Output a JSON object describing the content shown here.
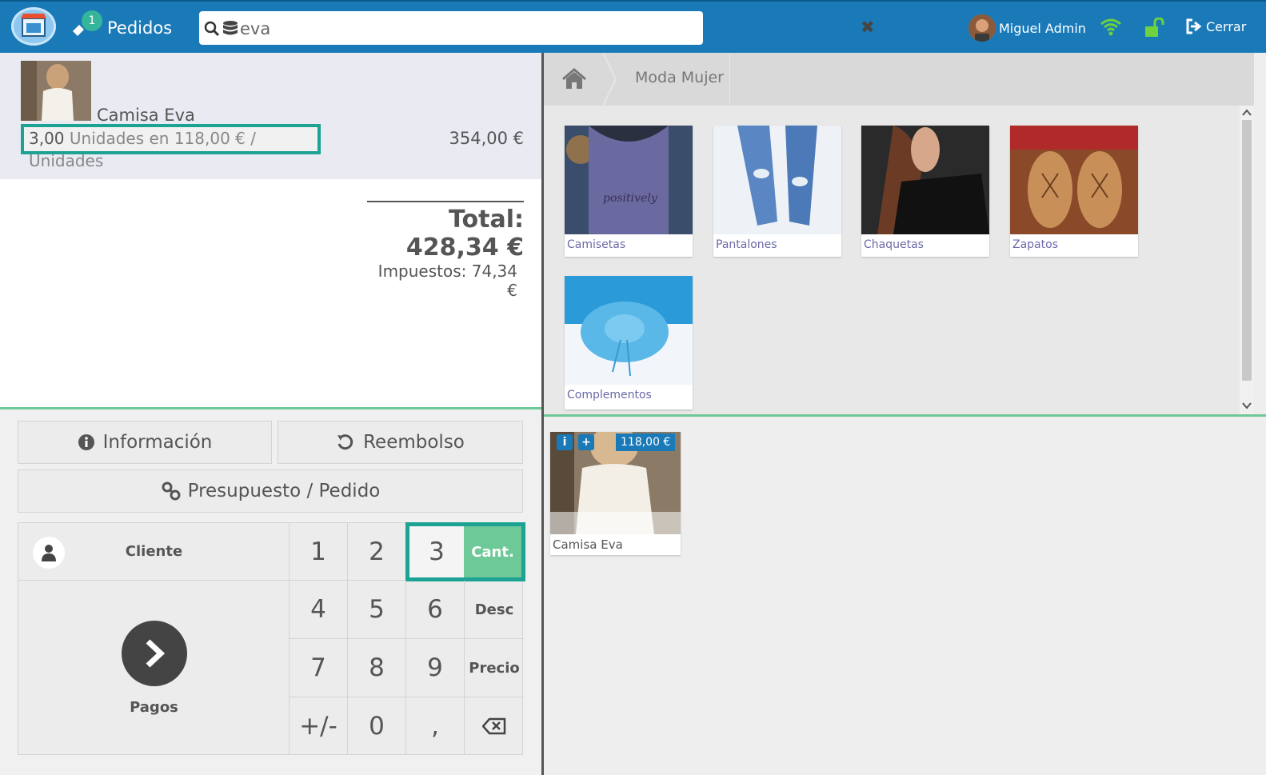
{
  "header": {
    "orders_badge": "1",
    "orders_label": "Pedidos",
    "search_value": "eva",
    "user_name": "Miguel Admin",
    "logout_label": "Cerrar"
  },
  "order": {
    "line": {
      "product_name": "Camisa Eva",
      "quantity": "3,00",
      "detail": " Unidades en 118,00 € / Unidades",
      "line_total": "354,00 €"
    },
    "total_label": "Total: 428,34 €",
    "taxes_label": "Impuestos: 74,34 €"
  },
  "actions": {
    "info_label": "Información",
    "refund_label": "Reembolso",
    "quote_label": "Presupuesto / Pedido"
  },
  "numpad": {
    "client_label": "Cliente",
    "payment_label": "Pagos",
    "keys": [
      "1",
      "2",
      "3",
      "4",
      "5",
      "6",
      "7",
      "8",
      "9",
      "+/-",
      "0",
      ","
    ],
    "mode_qty": "Cant.",
    "mode_disc": "Desc",
    "mode_price": "Precio"
  },
  "breadcrumb": {
    "category": "Moda Mujer"
  },
  "categories": [
    {
      "label": "Camisetas"
    },
    {
      "label": "Pantalones"
    },
    {
      "label": "Chaquetas"
    },
    {
      "label": "Zapatos"
    },
    {
      "label": "Complementos"
    }
  ],
  "products": [
    {
      "name": "Camisa Eva",
      "price": "118,00 €"
    }
  ],
  "colors": {
    "brand": "#1a7ab8",
    "accent": "#1da394",
    "green": "#6ec998"
  }
}
